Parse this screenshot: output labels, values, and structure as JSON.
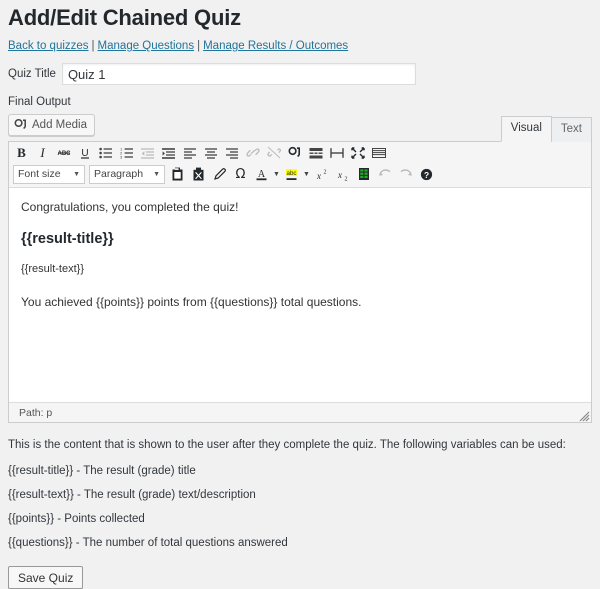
{
  "header": {
    "title": "Add/Edit Chained Quiz"
  },
  "nav": {
    "separator": "|",
    "links": [
      {
        "label": "Back to quizzes",
        "name": "back-to-quizzes-link"
      },
      {
        "label": "Manage Questions",
        "name": "manage-questions-link"
      },
      {
        "label": "Manage Results / Outcomes",
        "name": "manage-results-link"
      }
    ]
  },
  "form": {
    "quiz_title_label": "Quiz Title",
    "quiz_title_value": "Quiz 1",
    "quiz_title_placeholder": "",
    "final_output_label": "Final Output"
  },
  "editor": {
    "add_media_label": "Add Media",
    "tabs": [
      {
        "label": "Visual",
        "active": true
      },
      {
        "label": "Text",
        "active": false
      }
    ],
    "toolbar_row1": [
      {
        "name": "bold-icon",
        "glyph": "B",
        "title": "Bold",
        "disabled": false
      },
      {
        "name": "italic-icon",
        "glyph": "I",
        "title": "Italic",
        "disabled": false
      },
      {
        "name": "strikethrough-icon",
        "glyph": "ABC",
        "title": "Strikethrough",
        "disabled": false
      },
      {
        "name": "underline-icon",
        "glyph": "U",
        "title": "Underline",
        "disabled": false
      },
      {
        "name": "bullet-list-icon",
        "glyph": "list",
        "title": "Unordered list",
        "disabled": false
      },
      {
        "name": "numbered-list-icon",
        "glyph": "list",
        "title": "Ordered list",
        "disabled": false
      },
      {
        "name": "outdent-icon",
        "glyph": "list",
        "title": "Outdent",
        "disabled": true
      },
      {
        "name": "blockquote-icon",
        "glyph": "list",
        "title": "Blockquote",
        "disabled": false
      },
      {
        "name": "align-left-icon",
        "glyph": "list",
        "title": "Align left",
        "disabled": false
      },
      {
        "name": "align-center-icon",
        "glyph": "list",
        "title": "Align center",
        "disabled": false
      },
      {
        "name": "align-right-icon",
        "glyph": "list",
        "title": "Align right",
        "disabled": false
      },
      {
        "name": "insert-link-icon",
        "glyph": "link",
        "title": "Insert/edit link",
        "disabled": true
      },
      {
        "name": "unlink-icon",
        "glyph": "link",
        "title": "Remove link",
        "disabled": true
      },
      {
        "name": "insert-image-icon",
        "glyph": "image",
        "title": "Insert image",
        "disabled": false
      },
      {
        "name": "insert-more-tag-icon",
        "glyph": "more",
        "title": "Insert Read More tag",
        "disabled": false
      },
      {
        "name": "insert-page-break-icon",
        "glyph": "pagebreak",
        "title": "Insert Page Break tag",
        "disabled": false
      },
      {
        "name": "fullscreen-icon",
        "glyph": "fullscreen",
        "title": "Fullscreen",
        "disabled": false
      },
      {
        "name": "toolbar-toggle-icon",
        "glyph": "kitchensink",
        "title": "Toolbar Toggle",
        "disabled": false
      }
    ],
    "toolbar_row2": {
      "font_size_label": "Font size",
      "paragraph_label": "Paragraph",
      "buttons": [
        {
          "name": "paste-as-text-icon",
          "title": "Paste as text",
          "disabled": false
        },
        {
          "name": "remove-formatting-icon",
          "title": "Clear formatting",
          "disabled": false
        },
        {
          "name": "format-painter-icon",
          "title": "Format painter",
          "disabled": false
        },
        {
          "name": "special-character-icon",
          "glyph": "Ω",
          "title": "Special character",
          "disabled": false
        },
        {
          "name": "text-color-icon",
          "glyph": "A",
          "title": "Text color",
          "disabled": false
        },
        {
          "name": "background-color-icon",
          "glyph": "abc",
          "title": "Background color",
          "disabled": false
        },
        {
          "name": "superscript-icon",
          "title": "Superscript",
          "disabled": false
        },
        {
          "name": "subscript-icon",
          "title": "Subscript",
          "disabled": false
        },
        {
          "name": "insert-table-icon",
          "title": "Table",
          "disabled": false
        },
        {
          "name": "undo-icon",
          "title": "Undo",
          "disabled": true
        },
        {
          "name": "redo-icon",
          "title": "Redo",
          "disabled": true
        },
        {
          "name": "help-icon",
          "glyph": "?",
          "title": "Keyboard shortcuts",
          "disabled": false
        }
      ]
    },
    "content": {
      "line1": "Congratulations, you completed the quiz!",
      "heading": "{{result-title}}",
      "line2": "{{result-text}}",
      "line3": "You achieved {{points}} points from {{questions}} total questions."
    },
    "status_path": "Path: p"
  },
  "help": {
    "intro": "This is the content that is shown to the user after they complete the quiz. The following variables can be used:",
    "variables": [
      "{{result-title}} - The result (grade) title",
      "{{result-text}} - The result (grade) text/description",
      "{{points}} - Points collected",
      "{{questions}} - The number of total questions answered"
    ]
  },
  "actions": {
    "save_label": "Save Quiz"
  },
  "colors": {
    "page_background": "#f1f1f1",
    "link": "#21759b",
    "text": "#32373c",
    "editor_chrome": "#f5f5f5",
    "border": "#cccccc",
    "highlight_yellow": "#ffff00",
    "table_green": "#22aa22"
  }
}
